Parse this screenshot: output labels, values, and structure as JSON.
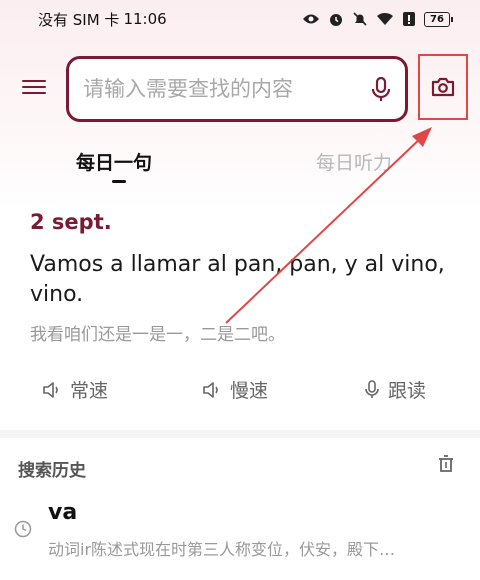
{
  "status_bar": {
    "carrier": "没有 SIM 卡",
    "time": "11:06",
    "battery": "76"
  },
  "search": {
    "placeholder": "请输入需要查找的内容"
  },
  "tabs": [
    {
      "label": "每日一句",
      "active": true
    },
    {
      "label": "每日听力",
      "active": false
    }
  ],
  "daily": {
    "date": "2 sept.",
    "sentence": "Vamos a llamar al pan, pan, y al vino, vino.",
    "translation": "我看咱们还是一是一，二是二吧。"
  },
  "actions": {
    "normal": "常速",
    "slow": "慢速",
    "follow": "跟读"
  },
  "history": {
    "title": "搜索历史",
    "items": [
      {
        "word": "va",
        "desc": "动词ir陈述式现在时第三人称变位，伏安，殿下…"
      }
    ]
  },
  "colors": {
    "accent": "#7a1a35",
    "highlight": "#e04848"
  }
}
